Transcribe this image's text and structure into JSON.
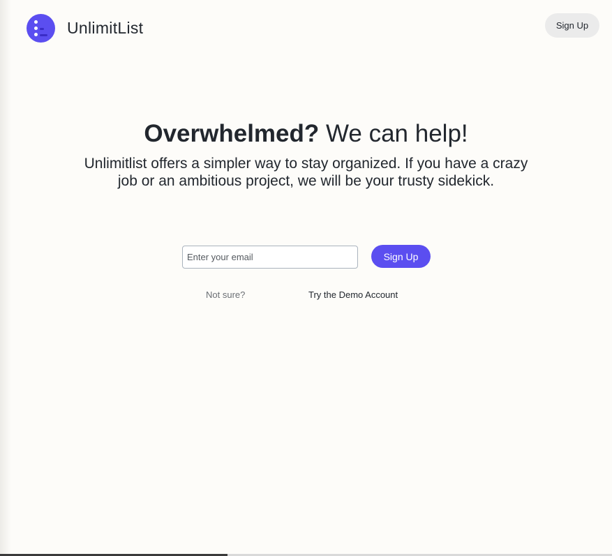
{
  "header": {
    "brand_name": "UnlimitList",
    "signup_label": "Sign Up"
  },
  "hero": {
    "headline_bold": "Overwhelmed?",
    "headline_rest": " We can help!",
    "subtext": "Unlimitlist offers a simpler way to stay organized. If you have a crazy job or an ambitious project, we will be your trusty sidekick."
  },
  "signup_form": {
    "email_placeholder": "Enter your email",
    "submit_label": "Sign Up"
  },
  "demo": {
    "prompt": "Not sure?",
    "link_label": "Try the Demo Account"
  },
  "icons": {
    "logo": "list-logo-icon"
  },
  "colors": {
    "accent": "#5b4ef0",
    "background": "#fdfcf9",
    "text": "#22272e",
    "secondary_button_bg": "#ebebeb"
  }
}
